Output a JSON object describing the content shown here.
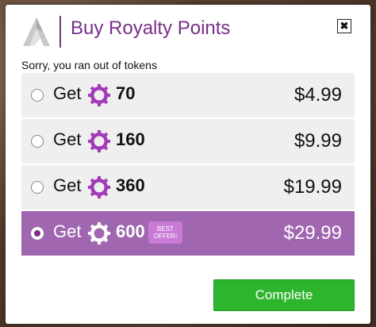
{
  "dialog": {
    "title": "Buy Royalty Points",
    "close_label": "✖",
    "subtitle": "Sorry, you ran out of tokens",
    "colors": {
      "title": "#7a2f88",
      "selected_row": "#a066b0",
      "row": "#efefef",
      "complete_button": "#2db52d"
    }
  },
  "options": [
    {
      "get_label": "Get",
      "amount": "70",
      "price": "$4.99",
      "selected": false
    },
    {
      "get_label": "Get",
      "amount": "160",
      "price": "$9.99",
      "selected": false
    },
    {
      "get_label": "Get",
      "amount": "360",
      "price": "$19.99",
      "selected": false
    },
    {
      "get_label": "Get",
      "amount": "600",
      "price": "$29.99",
      "selected": true,
      "badge": "BEST OFFER!"
    }
  ],
  "footer": {
    "complete_label": "Complete"
  }
}
